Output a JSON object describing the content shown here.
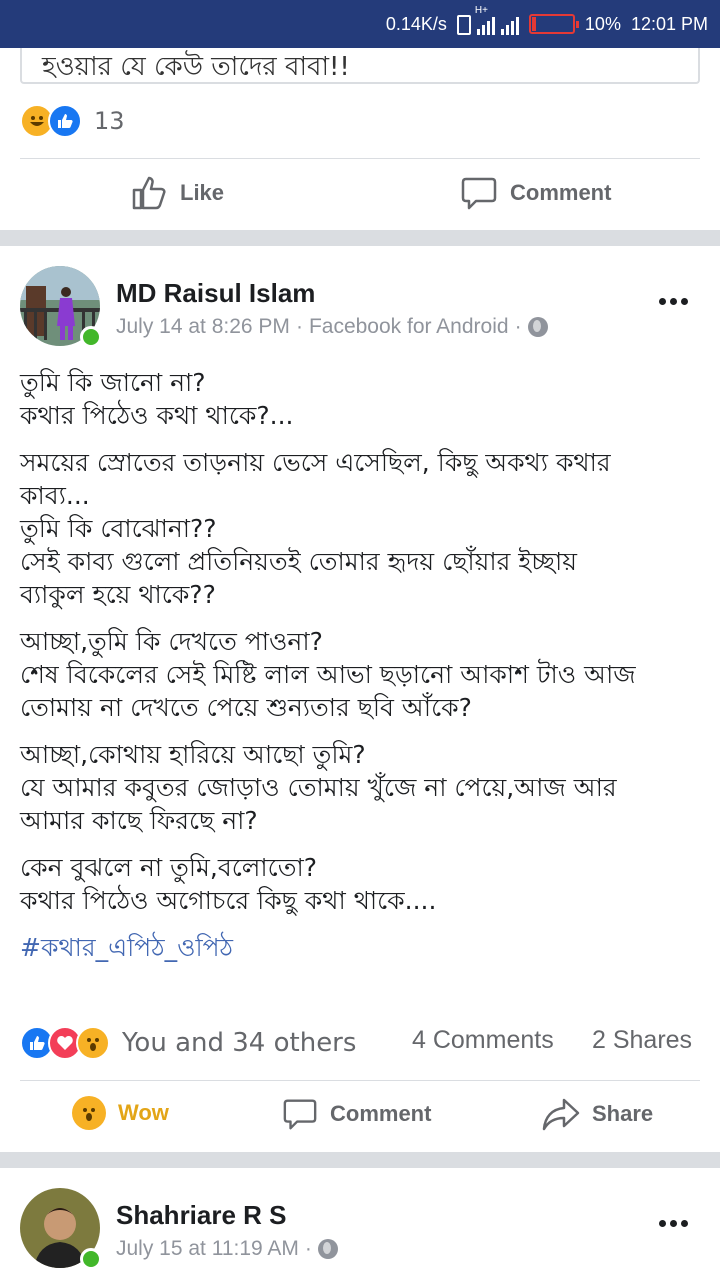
{
  "status_bar": {
    "speed": "0.14K/s",
    "network": "H+",
    "battery": "10%",
    "time": "12:01 PM"
  },
  "prev_post": {
    "text_tail": "হওয়ার যে কেউ তাদের বাবা!!",
    "reaction_count": "13",
    "actions": {
      "like": "Like",
      "comment": "Comment"
    }
  },
  "post": {
    "author": "MD Raisul Islam",
    "timestamp": "July 14 at 8:26 PM",
    "source": "Facebook for Android",
    "body": [
      [
        "তুমি কি জানো না?",
        "কথার পিঠেও কথা থাকে?..."
      ],
      [
        "সময়ের স্রোতের তাড়নায় ভেসে এসেছিল, কিছু অকথ্য কথার",
        "কাব্য...",
        "তুমি কি বোঝোনা??",
        "সেই কাব্য গুলো প্রতিনিয়তই তোমার হৃদয় ছোঁয়ার ইচ্ছায়",
        "ব্যাকুল হয়ে থাকে??"
      ],
      [
        "আচ্ছা,তুমি কি দেখতে পাওনা?",
        "শেষ বিকেলের সেই মিষ্টি লাল আভা ছড়ানো আকাশ টাও আজ",
        "তোমায় না দেখতে পেয়ে শুন্যতার ছবি আঁকে?"
      ],
      [
        "আচ্ছা,কোথায় হারিয়ে আছো তুমি?",
        "যে আমার কবুতর জোড়াও তোমায় খুঁজে না পেয়ে,আজ আর",
        "আমার কাছে ফিরছে না?"
      ],
      [
        "কেন বুঝলে না তুমি,বলোতো?",
        "কথার পিঠেও অগোচরে কিছু কথা থাকে...."
      ]
    ],
    "hashtag": "#কথার_এপিঠ_ওপিঠ",
    "reactions_text": "You and 34 others",
    "comments_count": "4 Comments",
    "shares_count": "2 Shares",
    "actions": {
      "wow": "Wow",
      "comment": "Comment",
      "share": "Share"
    }
  },
  "next_post": {
    "author": "Shahriare R S",
    "timestamp": "July 15 at 11:19 AM"
  },
  "colors": {
    "status_bar": "#243b7a",
    "wow": "#f7b125",
    "link": "#4267b2"
  }
}
